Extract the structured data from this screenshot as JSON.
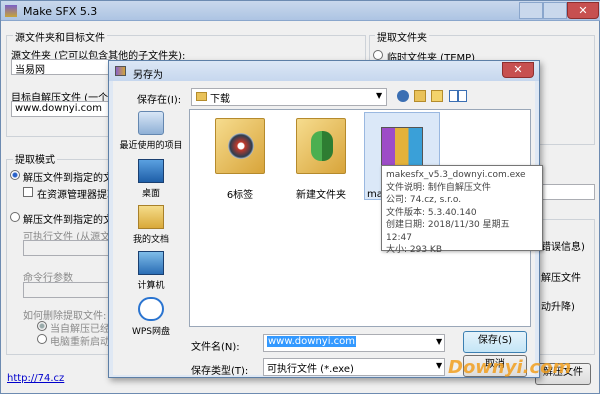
{
  "main_window": {
    "title": "Make SFX 5.3",
    "source_group_title": "源文件夹和目标文件",
    "source_folder_label": "源文件夹 (它可以包含其他的子文件夹):",
    "source_folder_value": "当易网",
    "target_file_label": "目标自解压文件 (一个",
    "target_file_value": "www.downyi.com",
    "extract_group_title": "提取文件夹",
    "temp_folder_option": "临时文件夹 (TEMP)",
    "extract_mode_title": "提取模式",
    "mode_option_1": "解压文件到指定的文件",
    "mode_option_1_sub": "在资源管理器提取",
    "mode_option_2": "解压文件到指定的文件",
    "exe_label": "可执行文件 (从源文件",
    "cmd_args_label": "命令行参数",
    "delete_label": "如何删除提取文件:",
    "delete_option_1": "当自解压已经执行",
    "delete_option_2": "电脑重新启动后",
    "right_frag_1": "错误信息)",
    "right_frag_2": "解压文件",
    "right_frag_3": "动升降)",
    "link": "http://74.cz",
    "bottom_btn": "解压文件"
  },
  "save_dialog": {
    "title": "另存为",
    "save_in_label": "保存在(I):",
    "save_in_value": "下载",
    "places": [
      {
        "label": "最近使用的项目",
        "icon": "recent-icon"
      },
      {
        "label": "桌面",
        "icon": "desktop-icon"
      },
      {
        "label": "我的文档",
        "icon": "documents-icon"
      },
      {
        "label": "计算机",
        "icon": "computer-icon"
      },
      {
        "label": "WPS网盘",
        "icon": "cloud-icon"
      }
    ],
    "files": [
      {
        "name": "6标签"
      },
      {
        "name": "新建文件夹"
      },
      {
        "name": "make"
      }
    ],
    "tooltip": {
      "name": "makesfx_v5.3_downyi.com.exe",
      "desc": "文件说明: 制作自解压文件",
      "company": "公司: 74.cz, s.r.o.",
      "version": "文件版本: 5.3.40.140",
      "created": "创建日期: 2018/11/30 星期五 12:47",
      "size": "大小: 293 KB"
    },
    "filename_label": "文件名(N):",
    "filename_value": "www.downyi.com",
    "filetype_label": "保存类型(T):",
    "filetype_value": "可执行文件 (*.exe)",
    "save_button": "保存(S)",
    "cancel_button": "取消"
  },
  "watermark": "Downyi.com"
}
